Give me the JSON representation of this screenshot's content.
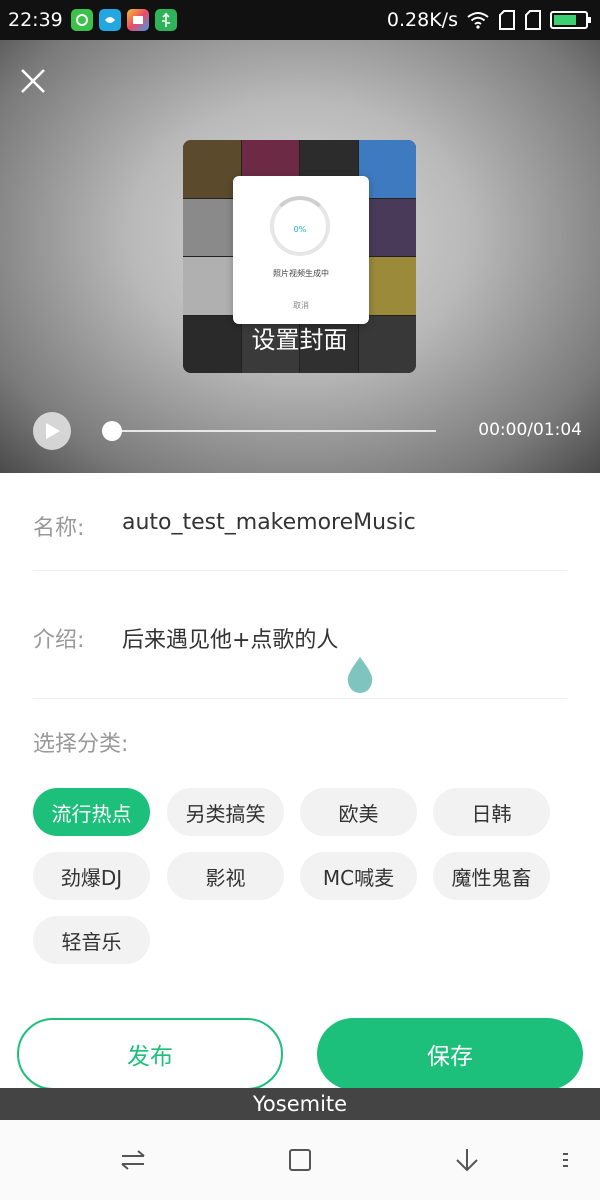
{
  "status_bar": {
    "time": "22:39",
    "network_speed": "0.28K/s",
    "app_icons": [
      "green-app-icon",
      "blue-app-icon",
      "gallery-app-icon",
      "usb-icon"
    ],
    "icons": [
      "wifi-icon",
      "sim1-icon",
      "sim2-icon",
      "battery-icon"
    ]
  },
  "preview": {
    "cover_caption": "设置封面",
    "progress_dialog": {
      "percent": "0%",
      "message": "照片视频生成中",
      "cancel": "取消"
    },
    "playback_time": "00:00/01:04",
    "playback_progress": 0
  },
  "form": {
    "name_label": "名称:",
    "name_value": "auto_test_makemoreMusic",
    "intro_label": "介绍:",
    "intro_value": "后来遇见他+点歌的人",
    "category_title": "选择分类:"
  },
  "categories": [
    {
      "label": "流行热点",
      "selected": true
    },
    {
      "label": "另类搞笑",
      "selected": false
    },
    {
      "label": "欧美",
      "selected": false
    },
    {
      "label": "日韩",
      "selected": false
    },
    {
      "label": "劲爆DJ",
      "selected": false
    },
    {
      "label": "影视",
      "selected": false
    },
    {
      "label": "MC喊麦",
      "selected": false
    },
    {
      "label": "魔性鬼畜",
      "selected": false
    },
    {
      "label": "轻音乐",
      "selected": false
    }
  ],
  "actions": {
    "publish": "发布",
    "save": "保存"
  },
  "host_bar": "Yosemite",
  "colors": {
    "accent": "#1cc07a",
    "progress_text": "#19b5c5"
  }
}
